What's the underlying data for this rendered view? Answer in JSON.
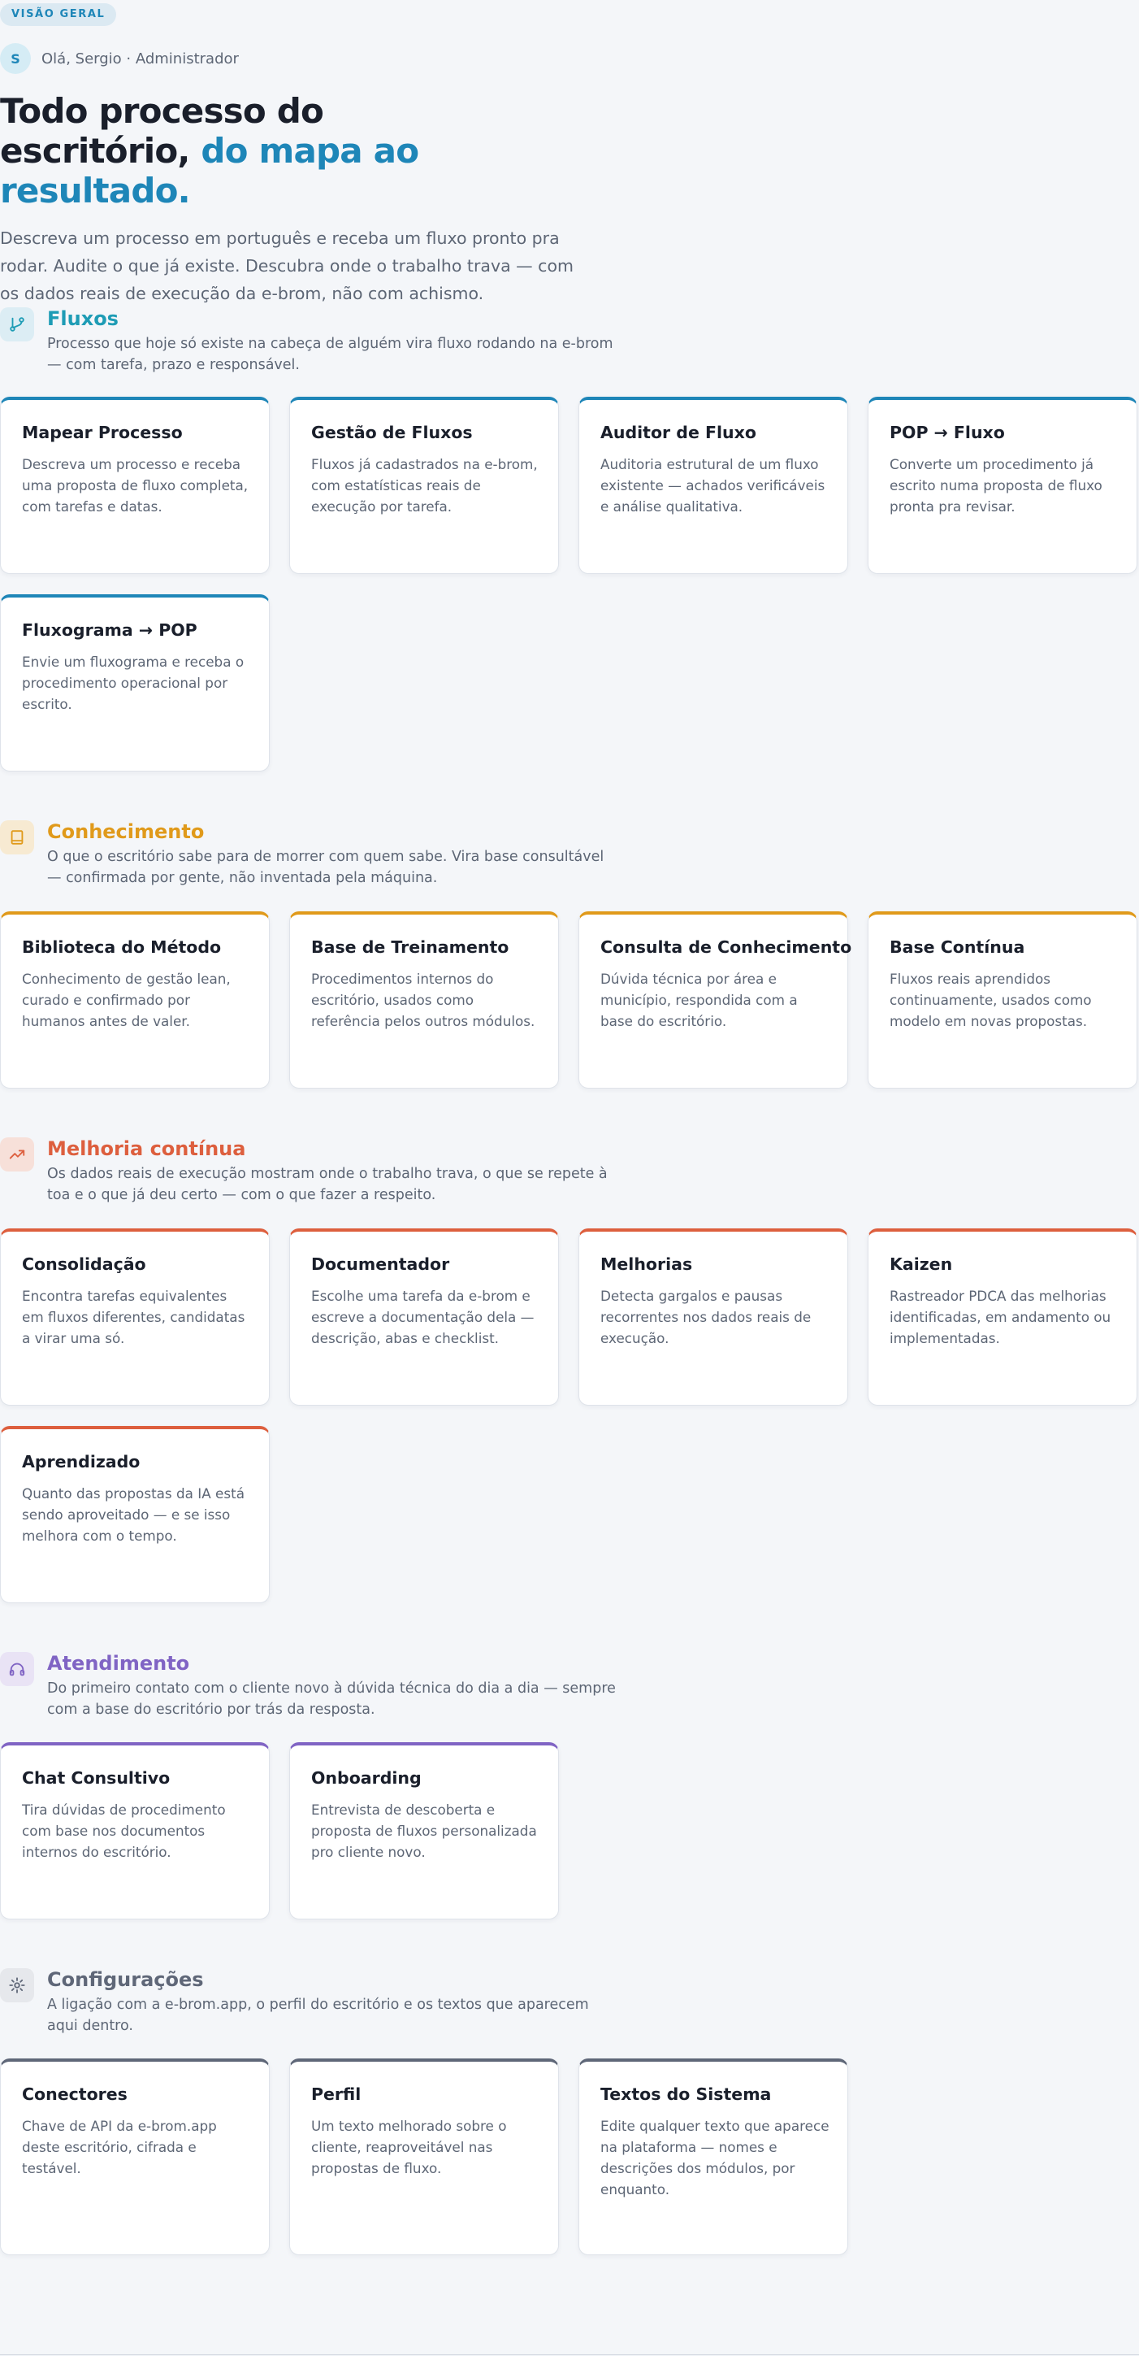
{
  "badge": "VISÃO GERAL",
  "user": {
    "initial": "S",
    "greeting": "Olá, Sergio · Administrador"
  },
  "hero": {
    "title_part1": "Todo processo do escritório,",
    "title_accent": "do mapa ao resultado.",
    "subtitle": "Descreva um processo em português e receba um fluxo pronto pra rodar. Audite o que já existe. Descubra onde o trabalho trava — com os dados reais de execução da e-brom, não com achismo."
  },
  "colors": {
    "fluxos": "#1e86b8",
    "fluxos_title": "#1e9cb5",
    "conhecimento": "#e09a1b",
    "melhoria": "#dd5f3e",
    "atendimento": "#8064c4",
    "configuracoes": "#5f6778"
  },
  "sections": [
    {
      "icon": "branch-icon",
      "title": "Fluxos",
      "description": "Processo que hoje só existe na cabeça de alguém vira fluxo rodando na e-brom — com tarefa, prazo e responsável.",
      "cards": [
        {
          "title": "Mapear Processo",
          "description": "Descreva um processo e receba uma proposta de fluxo completa, com tarefas e datas."
        },
        {
          "title": "Gestão de Fluxos",
          "description": "Fluxos já cadastrados na e-brom, com estatísticas reais de execução por tarefa."
        },
        {
          "title": "Auditor de Fluxo",
          "description": "Auditoria estrutural de um fluxo existente — achados verificáveis e análise qualitativa."
        },
        {
          "title": "POP → Fluxo",
          "description": "Converte um procedimento já escrito numa proposta de fluxo pronta pra revisar."
        },
        {
          "title": "Fluxograma → POP",
          "description": "Envie um fluxograma e receba o procedimento operacional por escrito."
        }
      ]
    },
    {
      "icon": "book-icon",
      "title": "Conhecimento",
      "description": "O que o escritório sabe para de morrer com quem sabe. Vira base consultável — confirmada por gente, não inventada pela máquina.",
      "cards": [
        {
          "title": "Biblioteca do Método",
          "description": "Conhecimento de gestão lean, curado e confirmado por humanos antes de valer."
        },
        {
          "title": "Base de Treinamento",
          "description": "Procedimentos internos do escritório, usados como referência pelos outros módulos."
        },
        {
          "title": "Consulta de Conhecimento",
          "description": "Dúvida técnica por área e município, respondida com a base do escritório."
        },
        {
          "title": "Base Contínua",
          "description": "Fluxos reais aprendidos continuamente, usados como modelo em novas propostas."
        }
      ]
    },
    {
      "icon": "trending-up-icon",
      "title": "Melhoria contínua",
      "description": "Os dados reais de execução mostram onde o trabalho trava, o que se repete à toa e o que já deu certo — com o que fazer a respeito.",
      "cards": [
        {
          "title": "Consolidação",
          "description": "Encontra tarefas equivalentes em fluxos diferentes, candidatas a virar uma só."
        },
        {
          "title": "Documentador",
          "description": "Escolhe uma tarefa da e-brom e escreve a documentação dela — descrição, abas e checklist."
        },
        {
          "title": "Melhorias",
          "description": "Detecta gargalos e pausas recorrentes nos dados reais de execução."
        },
        {
          "title": "Kaizen",
          "description": "Rastreador PDCA das melhorias identificadas, em andamento ou implementadas."
        },
        {
          "title": "Aprendizado",
          "description": "Quanto das propostas da IA está sendo aproveitado — e se isso melhora com o tempo."
        }
      ]
    },
    {
      "icon": "headphones-icon",
      "title": "Atendimento",
      "description": "Do primeiro contato com o cliente novo à dúvida técnica do dia a dia — sempre com a base do escritório por trás da resposta.",
      "cards": [
        {
          "title": "Chat Consultivo",
          "description": "Tira dúvidas de procedimento com base nos documentos internos do escritório."
        },
        {
          "title": "Onboarding",
          "description": "Entrevista de descoberta e proposta de fluxos personalizada pro cliente novo."
        }
      ]
    },
    {
      "icon": "gear-icon",
      "title": "Configurações",
      "description": "A ligação com a e-brom.app, o perfil do escritório e os textos que aparecem aqui dentro.",
      "cards": [
        {
          "title": "Conectores",
          "description": "Chave de API da e-brom.app deste escritório, cifrada e testável."
        },
        {
          "title": "Perfil",
          "description": "Um texto melhorado sobre o cliente, reaproveitável nas propostas de fluxo."
        },
        {
          "title": "Textos do Sistema",
          "description": "Edite qualquer texto que aparece na plataforma — nomes e descrições dos módulos, por enquanto."
        }
      ]
    }
  ]
}
